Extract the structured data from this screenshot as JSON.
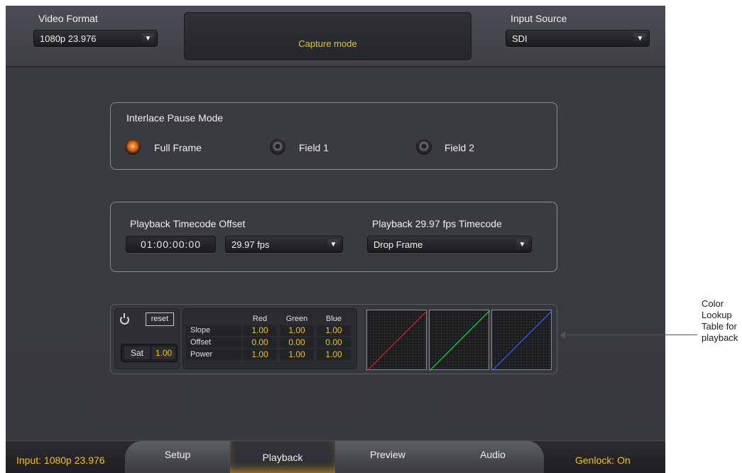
{
  "header": {
    "video_format_label": "Video Format",
    "video_format_value": "1080p 23.976",
    "status_text": "Capture mode",
    "input_source_label": "Input Source",
    "input_source_value": "SDI"
  },
  "interlace": {
    "title": "Interlace Pause Mode",
    "options": [
      {
        "label": "Full Frame",
        "selected": true
      },
      {
        "label": "Field 1",
        "selected": false
      },
      {
        "label": "Field 2",
        "selected": false
      }
    ]
  },
  "timecode": {
    "offset_label": "Playback Timecode Offset",
    "offset_value": "01:00:00:00",
    "fps_value": "29.97 fps",
    "drop_label": "Playback 29.97 fps Timecode",
    "drop_value": "Drop Frame"
  },
  "lut": {
    "reset_label": "reset",
    "sat_label": "Sat",
    "sat_value": "1.00",
    "columns": [
      "Red",
      "Green",
      "Blue"
    ],
    "rows": [
      {
        "label": "Slope",
        "values": [
          "1.00",
          "1.00",
          "1.00"
        ]
      },
      {
        "label": "Offset",
        "values": [
          "0.00",
          "0.00",
          "0.00"
        ]
      },
      {
        "label": "Power",
        "values": [
          "1.00",
          "1.00",
          "1.00"
        ]
      }
    ],
    "curve_colors": [
      "#e02020",
      "#20d040",
      "#3060ff"
    ]
  },
  "footer": {
    "input_status": "Input: 1080p 23.976",
    "genlock_status": "Genlock: On",
    "tabs": [
      {
        "label": "Setup",
        "active": false
      },
      {
        "label": "Playback",
        "active": true
      },
      {
        "label": "Preview",
        "active": false
      },
      {
        "label": "Audio",
        "active": false
      }
    ]
  },
  "annotation": {
    "lines": [
      "Color",
      "Lookup",
      "Table for",
      "playback"
    ]
  },
  "colors": {
    "accent": "#f0c020",
    "background": "#393c41"
  }
}
